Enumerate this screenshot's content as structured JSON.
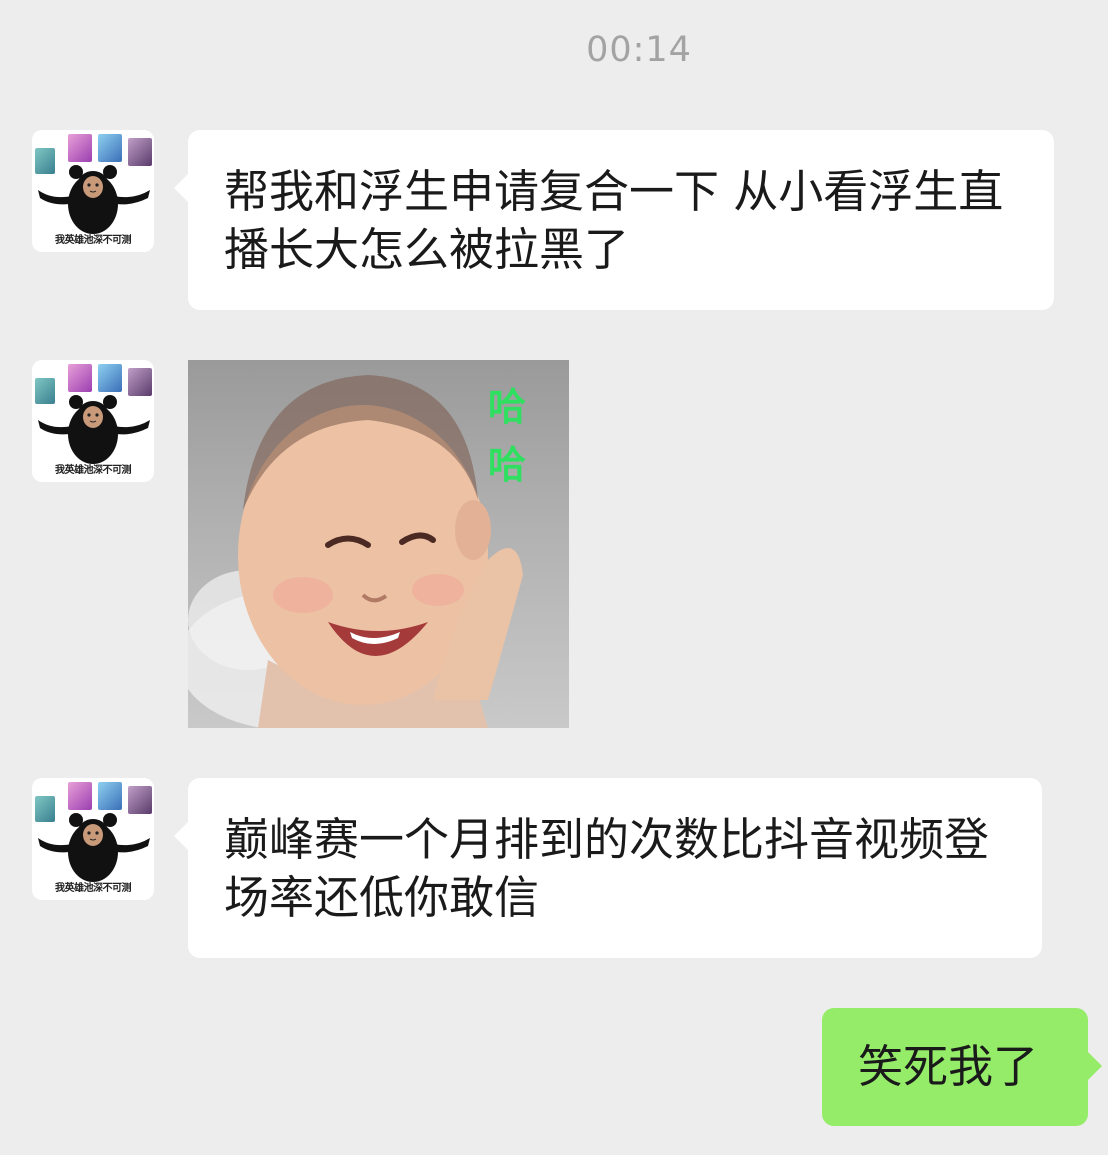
{
  "status": {
    "time": "00:14"
  },
  "contact": {
    "avatar_caption": "我英雄池深不可测",
    "avatar_icon": "bear-meme-avatar-icon"
  },
  "messages": [
    {
      "from": "contact",
      "type": "text",
      "text": "帮我和浮生申请复合一下 从小看浮生直播长大怎么被拉黑了"
    },
    {
      "from": "contact",
      "type": "sticker",
      "sticker_text": [
        "哈",
        "哈"
      ],
      "sticker_icon": "laughing-baby-sticker"
    },
    {
      "from": "contact",
      "type": "text",
      "text": "巅峰赛一个月排到的次数比抖音视频登场率还低你敢信"
    },
    {
      "from": "me",
      "type": "text",
      "text": "笑死我了"
    }
  ],
  "colors": {
    "background": "#ededed",
    "incoming_bubble": "#ffffff",
    "outgoing_bubble": "#95ec69",
    "timestamp": "#a3a3a3"
  }
}
